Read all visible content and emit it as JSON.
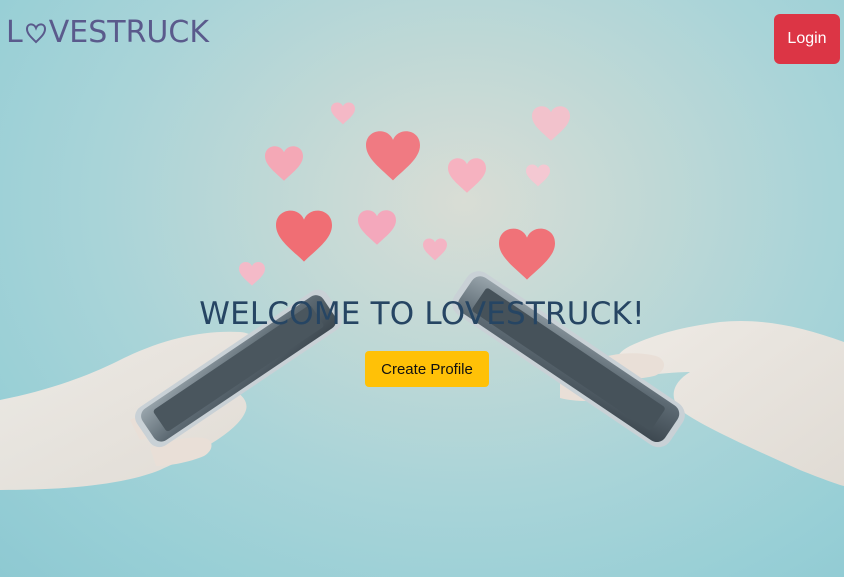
{
  "header": {
    "logo_prefix": "L",
    "logo_suffix": "VESTRUCK",
    "login_label": "Login"
  },
  "hero": {
    "title": "WELCOME TO LOVESTRUCK!",
    "cta_label": "Create Profile"
  },
  "colors": {
    "login_button": "#dc3545",
    "cta_button": "#ffc107",
    "title_text": "#264563",
    "logo_text": "#5a5a8c"
  },
  "icons": [
    "heart-outline-icon",
    "heart-icon",
    "smartphone-icon",
    "hand-icon"
  ]
}
